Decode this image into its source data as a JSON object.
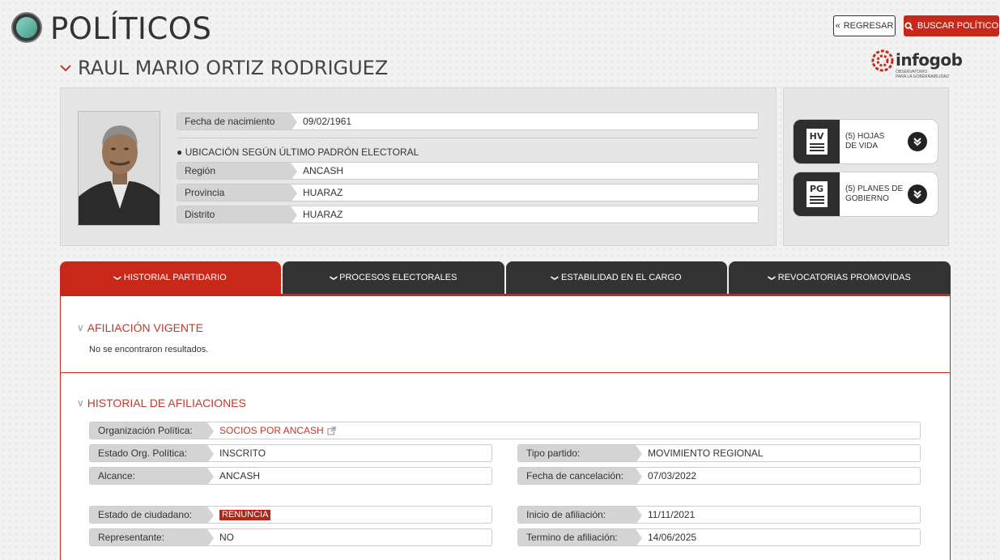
{
  "header": {
    "title": "POLÍTICOS",
    "back_label": "REGRESAR",
    "search_label": "BUSCAR POLÍTICO"
  },
  "politician": {
    "name": "RAUL MARIO ORTIZ RODRIGUEZ"
  },
  "brand": {
    "name": "infogob",
    "tagline_1": "OBSERVATORIO",
    "tagline_2": "PARA LA GOBERNABILIDAD"
  },
  "info": {
    "birth_label": "Fecha de nacimiento",
    "birth_value": "09/02/1961",
    "location_title": "UBICACIÓN SEGÚN ÚLTIMO PADRÓN ELECTORAL",
    "region_label": "Región",
    "region_value": "ANCASH",
    "provincia_label": "Provincia",
    "provincia_value": "HUARAZ",
    "distrito_label": "Distrito",
    "distrito_value": "HUARAZ"
  },
  "docs": {
    "hv_icon": "HV",
    "hv_line1": "(5) HOJAS",
    "hv_line2": "DE VIDA",
    "pg_icon": "PG",
    "pg_line1": "(5) PLANES DE",
    "pg_line2": "GOBIERNO"
  },
  "tabs": [
    {
      "label": "HISTORIAL PARTIDARIO"
    },
    {
      "label": "PROCESOS ELECTORALES"
    },
    {
      "label": "ESTABILIDAD EN EL CARGO"
    },
    {
      "label": "REVOCATORIAS PROMOVIDAS"
    }
  ],
  "afiliacion_vigente": {
    "title": "AFILIACIÓN VIGENTE",
    "empty_text": "No se encontraron resultados."
  },
  "historial": {
    "title": "HISTORIAL DE AFILIACIONES",
    "org_label": "Organización Política:",
    "org_value": "SOCIOS POR ANCASH",
    "estado_org_label": "Estado Org. Política:",
    "estado_org_value": "INSCRITO",
    "tipo_label": "Tipo partido:",
    "tipo_value": "MOVIMIENTO REGIONAL",
    "alcance_label": "Alcance:",
    "alcance_value": "ANCASH",
    "cancel_label": "Fecha de cancelación:",
    "cancel_value": "07/03/2022",
    "ciudadano_label": "Estado de ciudadano:",
    "ciudadano_value": "RENUNCIA",
    "inicio_label": "Inicio de afiliación:",
    "inicio_value": "11/11/2021",
    "rep_label": "Representante:",
    "rep_value": "NO",
    "termino_label": "Termino de afiliación:",
    "termino_value": "14/06/2025"
  },
  "colors": {
    "accent": "#c8281a",
    "dark_tab": "#333333"
  }
}
